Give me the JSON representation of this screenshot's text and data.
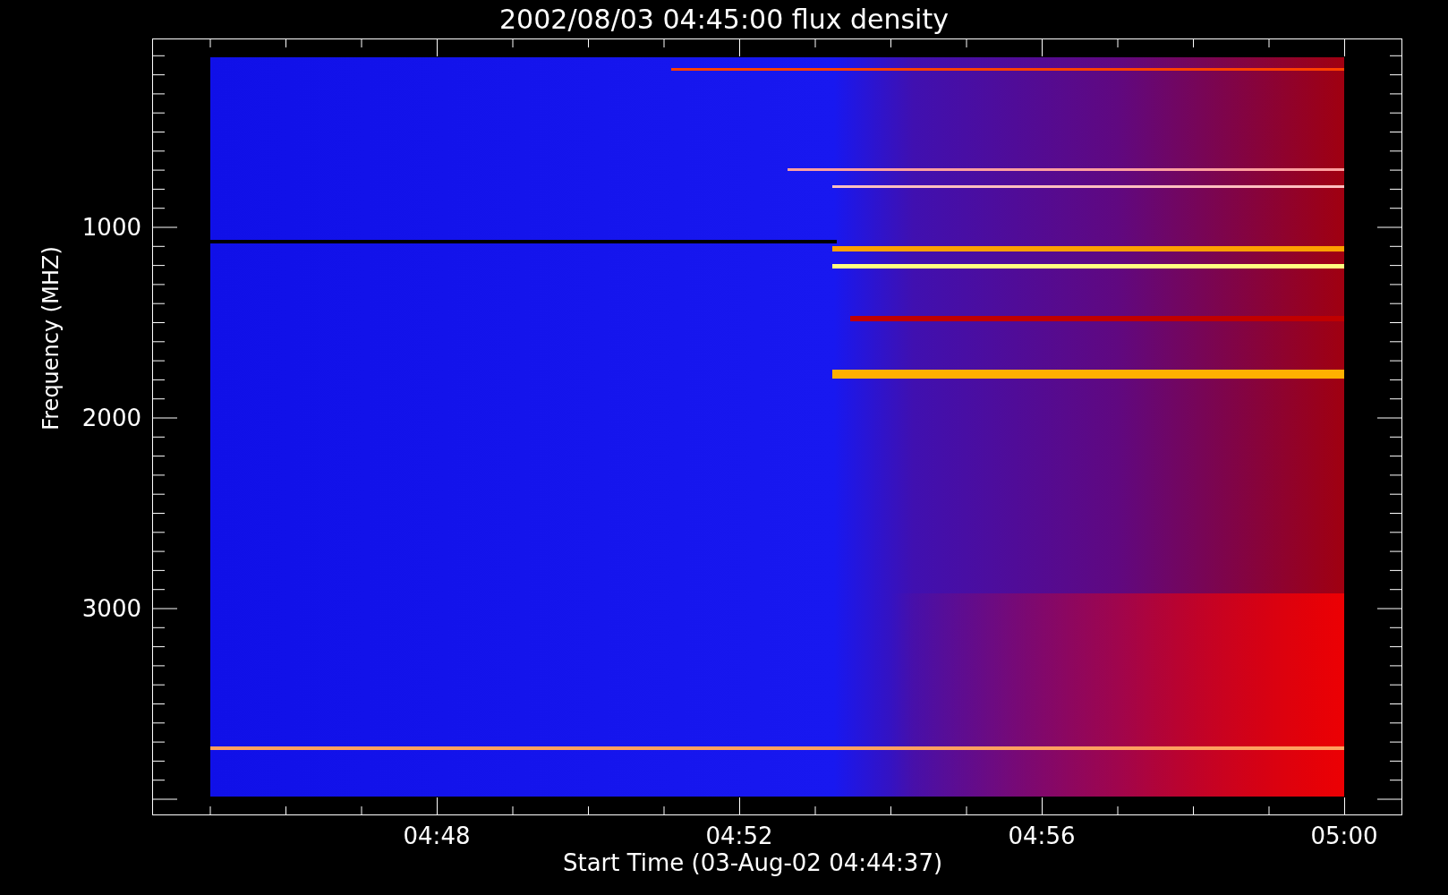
{
  "title": "2002/08/03 04:45:00 flux density",
  "y_axis": {
    "label": "Frequency (MHZ)",
    "ticks": [
      "1000",
      "2000",
      "3000"
    ]
  },
  "x_axis": {
    "label": "Start Time (03-Aug-02 04:44:37)",
    "ticks": [
      "04:48",
      "04:52",
      "04:56",
      "05:00"
    ]
  }
}
